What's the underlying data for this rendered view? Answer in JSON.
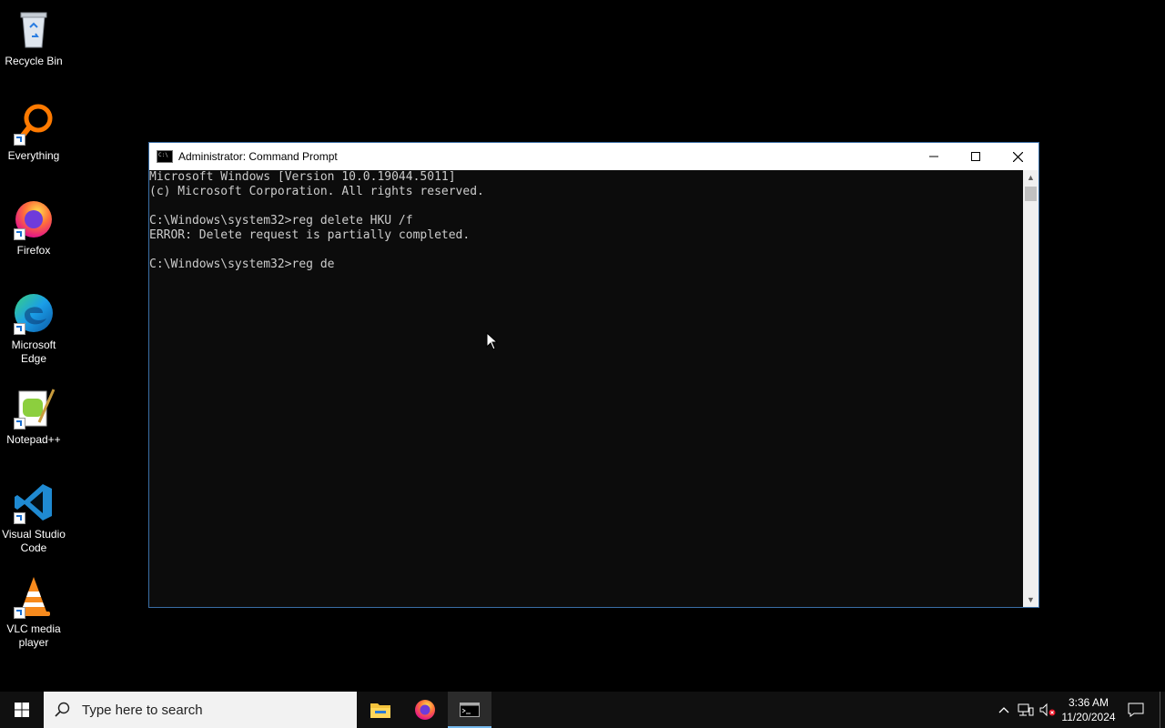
{
  "desktop": {
    "icons": [
      {
        "label": "Recycle Bin",
        "icon": "recycle-bin-icon"
      },
      {
        "label": "Everything",
        "icon": "everything-search-icon"
      },
      {
        "label": "Firefox",
        "icon": "firefox-icon"
      },
      {
        "label": "Microsoft Edge",
        "icon": "edge-icon"
      },
      {
        "label": "Notepad++",
        "icon": "notepadpp-icon"
      },
      {
        "label": "Visual Studio Code",
        "icon": "vscode-icon"
      },
      {
        "label": "VLC media player",
        "icon": "vlc-icon"
      }
    ]
  },
  "window": {
    "title": "Administrator: Command Prompt",
    "console_lines": [
      "Microsoft Windows [Version 10.0.19044.5011]",
      "(c) Microsoft Corporation. All rights reserved.",
      "",
      "C:\\Windows\\system32>reg delete HKU /f",
      "ERROR: Delete request is partially completed.",
      "",
      "C:\\Windows\\system32>reg de"
    ]
  },
  "taskbar": {
    "search_placeholder": "Type here to search",
    "pinned": [
      "file-explorer-icon",
      "firefox-icon",
      "command-prompt-icon"
    ],
    "clock_time": "3:36 AM",
    "clock_date": "11/20/2024"
  },
  "colors": {
    "console_bg": "#0c0c0c",
    "console_text": "#cccccc",
    "taskbar_bg": "#101010",
    "active_indicator": "#76b9ed"
  }
}
